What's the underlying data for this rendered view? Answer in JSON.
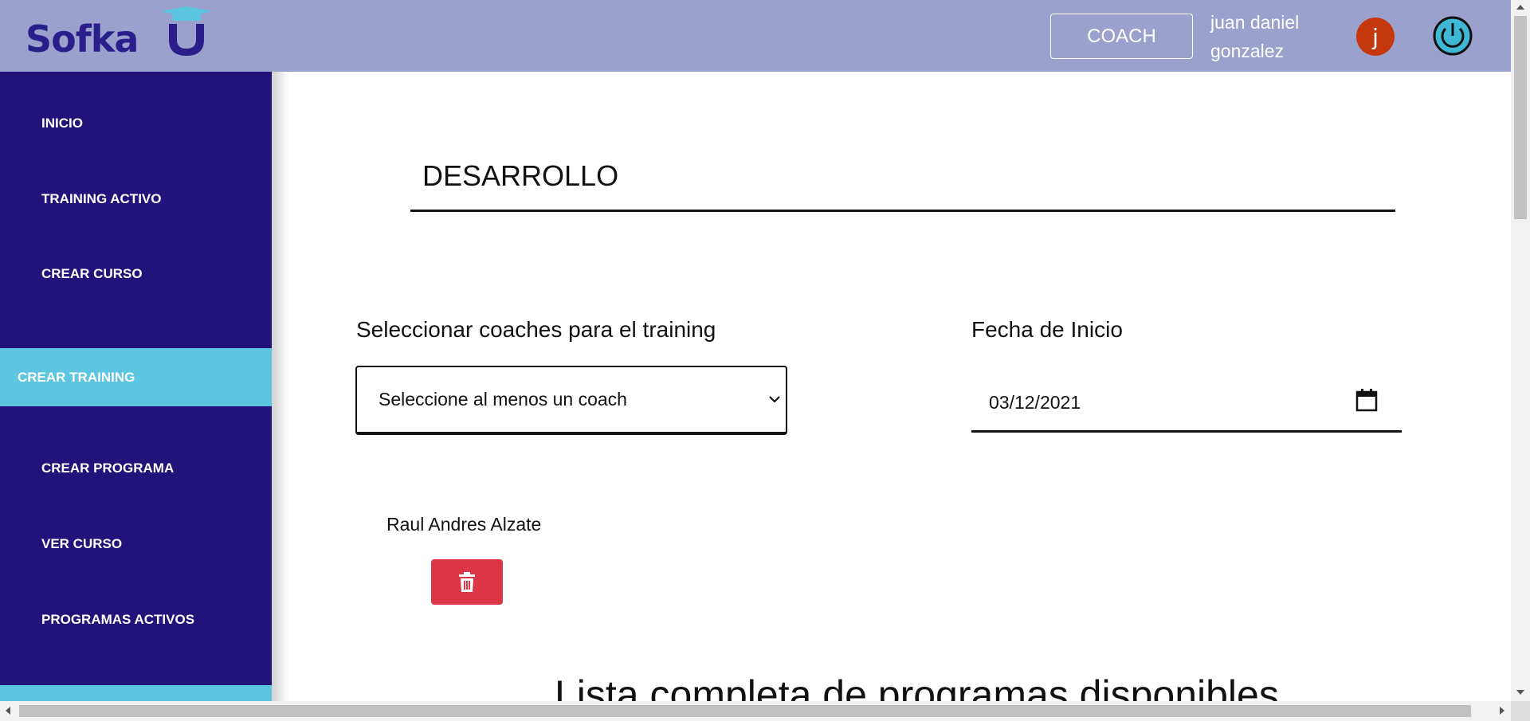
{
  "header": {
    "logo_text": "Sofka",
    "role_label": "COACH",
    "user_name": "juan daniel gonzalez",
    "avatar_letter": "j"
  },
  "sidebar": {
    "items": [
      {
        "label": "INICIO",
        "active": false
      },
      {
        "label": "TRAINING ACTIVO",
        "active": false
      },
      {
        "label": "CREAR CURSO",
        "active": false
      },
      {
        "label": "CREAR TRAINING",
        "active": true
      },
      {
        "label": "CREAR PROGRAMA",
        "active": false
      },
      {
        "label": "VER CURSO",
        "active": false
      },
      {
        "label": "PROGRAMAS ACTIVOS",
        "active": false
      }
    ]
  },
  "main": {
    "title": "DESARROLLO",
    "coaches_label": "Seleccionar coaches para el training",
    "coaches_select_value": "Seleccione al menos un coach",
    "start_date_label": "Fecha de Inicio",
    "start_date_value": "03/12/2021",
    "selected_coaches": [
      "Raul Andres Alzate"
    ],
    "programs_heading": "Lista completa de programas disponibles"
  },
  "colors": {
    "header_bg": "#9ba1cd",
    "sidebar_bg": "#211379",
    "active_item_bg": "#5cc5df",
    "avatar_bg": "#c5370d",
    "delete_button": "#dc3545"
  }
}
